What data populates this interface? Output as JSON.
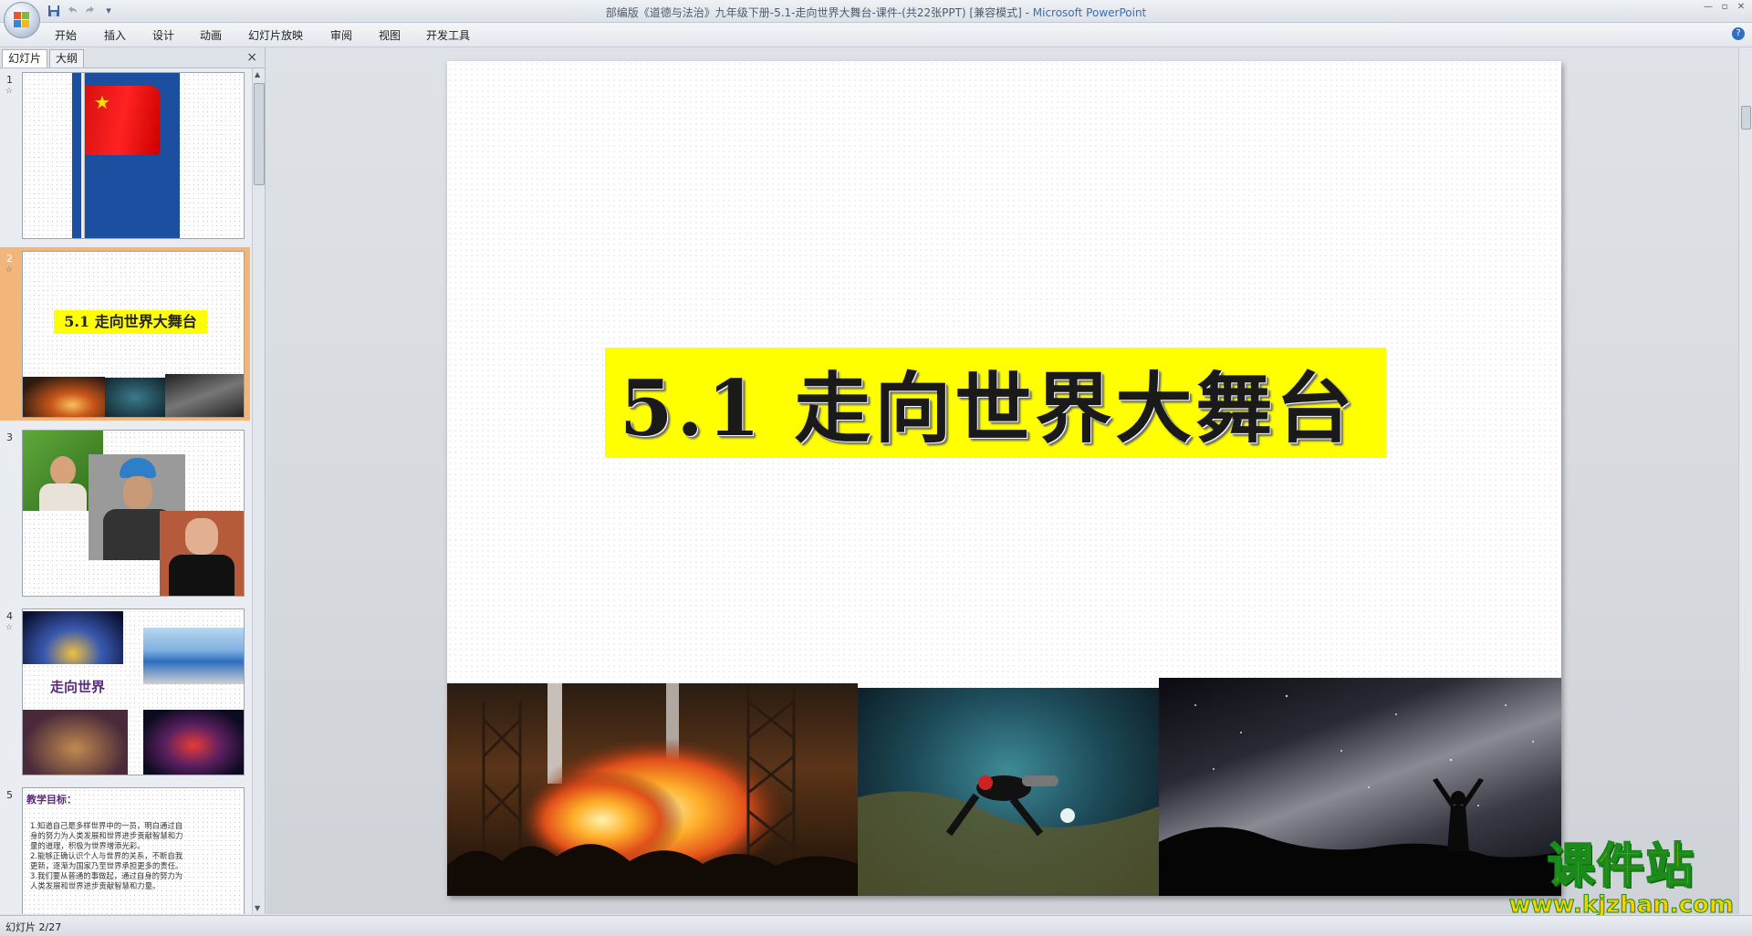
{
  "window": {
    "title": "部编版《道德与法治》九年级下册-5.1-走向世界大舞台-课件-(共22张PPT) [兼容模式]",
    "title_sep": " - ",
    "app_name": "Microsoft PowerPoint"
  },
  "quick_access": {
    "save": "save-icon",
    "undo": "undo-icon",
    "redo": "redo-icon",
    "customize": "dropdown-icon"
  },
  "menu": {
    "tabs": [
      "开始",
      "插入",
      "设计",
      "动画",
      "幻灯片放映",
      "审阅",
      "视图",
      "开发工具"
    ]
  },
  "panel": {
    "tabs": [
      "幻灯片",
      "大纲"
    ],
    "close": "×"
  },
  "thumbnails": [
    {
      "num": "1",
      "star": "☆"
    },
    {
      "num": "2",
      "star": "☆",
      "title": "5.1  走向世界大舞台"
    },
    {
      "num": "3",
      "star": ""
    },
    {
      "num": "4",
      "star": "☆",
      "caption": "走向世界"
    },
    {
      "num": "5",
      "star": "",
      "heading": "教学目标：",
      "lines": [
        "1.知道自己是多样世界中的一员，明白通过自",
        "身的努力为人类发展和世界进步贡献智慧和力",
        "量的道理，积极为世界增添光彩。",
        "2.能够正确认识个人与世界的关系，不断自我",
        "更新，逐渐为国家乃至世界承担更多的责任。",
        "3.我们要从普通的事做起，通过自身的努力为",
        "人类发展和世界进步贡献智慧和力量。"
      ]
    }
  ],
  "slide": {
    "title": "5.1   走向世界大舞台"
  },
  "status": {
    "text": "幻灯片 2/27"
  },
  "watermark": {
    "brand": "课件站",
    "url": "www.kjzhan.com"
  },
  "colors": {
    "title_bg": "#ffff00",
    "selected_thumb": "#f3b67a",
    "app_name": "#3b6cb7"
  }
}
